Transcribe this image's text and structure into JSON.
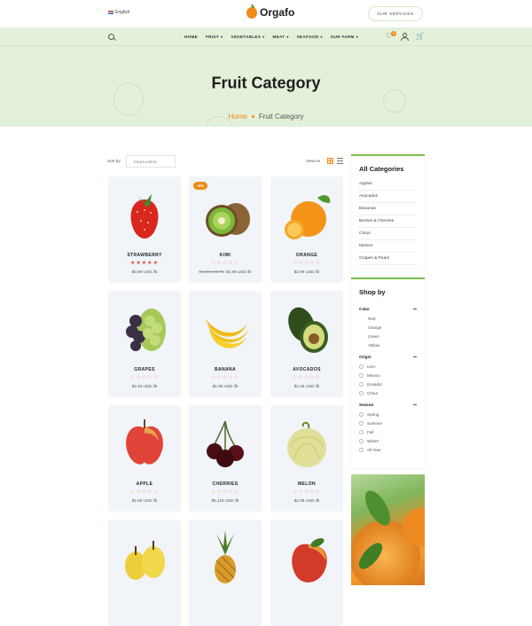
{
  "topbar": {
    "language": "English",
    "logo_text": "Orgafo",
    "services_button": "OUR SERVICES"
  },
  "nav": {
    "items": [
      {
        "label": "HOME",
        "caret": false
      },
      {
        "label": "FRUIT",
        "caret": true
      },
      {
        "label": "VEGETABLES",
        "caret": true
      },
      {
        "label": "MEAT",
        "caret": true
      },
      {
        "label": "SEAFOOD",
        "caret": true
      },
      {
        "label": "OUR FARM",
        "caret": true
      }
    ],
    "wishlist_count": "0"
  },
  "hero": {
    "title": "Fruit Category",
    "crumb_home": "Home",
    "crumb_current": "Fruit Category"
  },
  "toolbar": {
    "sort_label": "Sort by:",
    "sort_value": "FEATURED",
    "view_label": "View As"
  },
  "products": [
    {
      "name": "STRAWBERRY",
      "price": "$0.89 USD /lb",
      "old_price": "",
      "stars": 5,
      "badge": ""
    },
    {
      "name": "KIWI",
      "price": "$4.99 USD /lb",
      "old_price": "$5.29 USD /lb",
      "stars": 0,
      "badge": "-5%"
    },
    {
      "name": "ORANGE",
      "price": "$2.99 USD /lb",
      "old_price": "",
      "stars": 0,
      "badge": ""
    },
    {
      "name": "GRAPES",
      "price": "$3.49 USD /lb",
      "old_price": "",
      "stars": 0,
      "badge": ""
    },
    {
      "name": "BANANA",
      "price": "$1.99 USD /lb",
      "old_price": "",
      "stars": 0,
      "badge": ""
    },
    {
      "name": "AVOCADOS",
      "price": "$2.49 USD /lb",
      "old_price": "",
      "stars": 0,
      "badge": ""
    },
    {
      "name": "APPLE",
      "price": "$2.99 USD /lb",
      "old_price": "",
      "stars": 0,
      "badge": ""
    },
    {
      "name": "CHERRIES",
      "price": "$5.119 USD /lb",
      "old_price": "",
      "stars": 0,
      "badge": ""
    },
    {
      "name": "MELON",
      "price": "$2.99 USD /lb",
      "old_price": "",
      "stars": 0,
      "badge": ""
    },
    {
      "name": "",
      "price": "",
      "old_price": "",
      "stars": 0,
      "badge": ""
    },
    {
      "name": "",
      "price": "",
      "old_price": "",
      "stars": 0,
      "badge": ""
    },
    {
      "name": "",
      "price": "",
      "old_price": "",
      "stars": 0,
      "badge": ""
    }
  ],
  "sidebar": {
    "categories_title": "All Categories",
    "categories": [
      "Apples",
      "Avocados",
      "Bananas",
      "Berries & Cherries",
      "Citrus",
      "Melons",
      "Grapes & Pears"
    ],
    "shop_title": "Shop by",
    "filters": [
      {
        "label": "Color",
        "options": [
          "Red",
          "Orange",
          "Green",
          "Yellow"
        ],
        "checkbox": false
      },
      {
        "label": "Origin",
        "options": [
          "USA",
          "Mexico",
          "Ecuador",
          "China"
        ],
        "checkbox": true
      },
      {
        "label": "Season",
        "options": [
          "Spring",
          "Summer",
          "Fall",
          "Winter",
          "All Year"
        ],
        "checkbox": true
      }
    ]
  },
  "colors": {
    "accent": "#f28a16",
    "green": "#7cbf4e",
    "hero_bg": "#e3f1da",
    "star": "#e14b3b"
  }
}
